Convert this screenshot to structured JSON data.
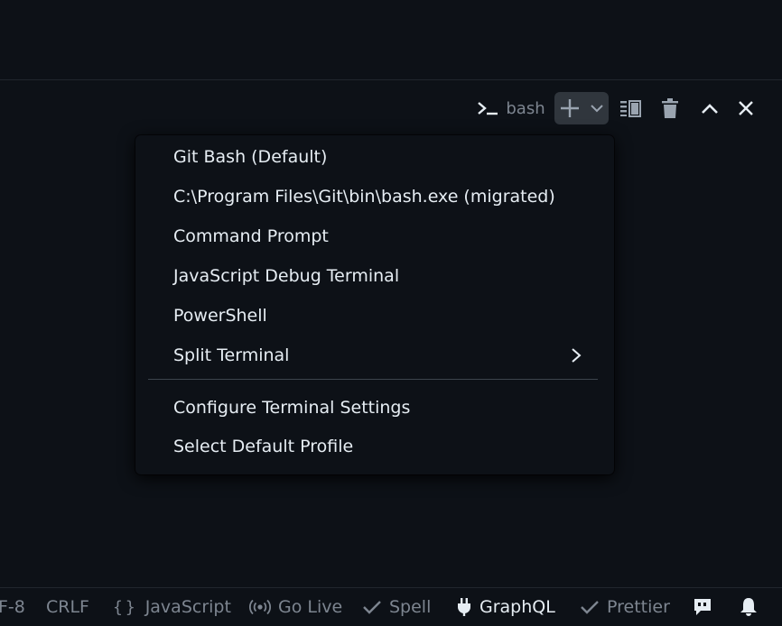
{
  "terminal": {
    "name": "bash",
    "icon": "terminal-prompt-icon"
  },
  "toolbar": {
    "new_terminal_icon": "plus-icon",
    "launch_profile_icon": "chevron-down-icon",
    "split_icon": "split-terminal-icon",
    "kill_icon": "trash-icon",
    "maximize_icon": "chevron-up-icon",
    "close_icon": "close-icon"
  },
  "menu": {
    "profiles": [
      {
        "label": "Git Bash (Default)"
      },
      {
        "label": "C:\\Program Files\\Git\\bin\\bash.exe (migrated)"
      },
      {
        "label": "Command Prompt"
      },
      {
        "label": "JavaScript Debug Terminal"
      },
      {
        "label": "PowerShell"
      },
      {
        "label": "Split Terminal",
        "has_submenu": true
      }
    ],
    "actions": [
      {
        "label": "Configure Terminal Settings"
      },
      {
        "label": "Select Default Profile"
      }
    ]
  },
  "statusbar": {
    "encoding": "F-8",
    "eol": "CRLF",
    "language": "JavaScript",
    "go_live": "Go Live",
    "spell": "Spell",
    "graphql": "GraphQL",
    "prettier": "Prettier"
  },
  "colors": {
    "background": "#0d1117",
    "text": "#e6edf3",
    "muted": "#7d8590",
    "button_bg": "#30363d"
  }
}
